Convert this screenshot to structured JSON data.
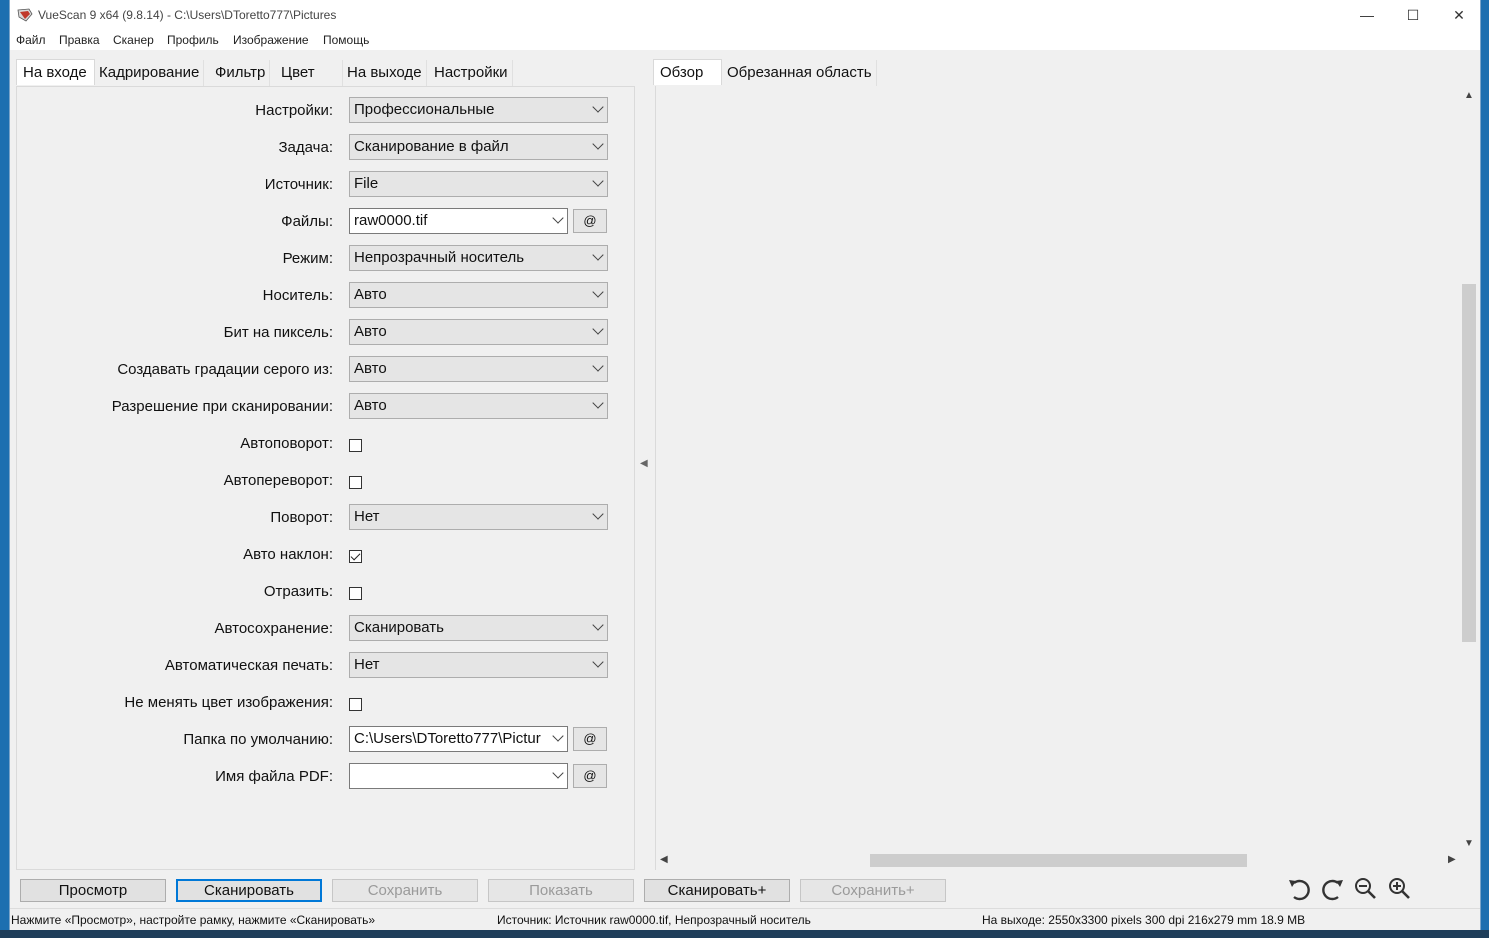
{
  "window": {
    "title": "VueScan 9 x64 (9.8.14) - C:\\Users\\DToretto777\\Pictures",
    "minimize": "—",
    "maximize": "☐",
    "close": "✕"
  },
  "menu": [
    "Файл",
    "Правка",
    "Сканер",
    "Профиль",
    "Изображение",
    "Помощь"
  ],
  "left_tabs": [
    "На входе",
    "Кадрирование",
    "Фильтр",
    "Цвет",
    "На выходе",
    "Настройки"
  ],
  "right_tabs": [
    "Обзор",
    "Обрезанная область"
  ],
  "form": {
    "settings": {
      "label": "Настройки:",
      "value": "Профессиональные"
    },
    "task": {
      "label": "Задача:",
      "value": "Сканирование в файл"
    },
    "source": {
      "label": "Источник:",
      "value": "File"
    },
    "files": {
      "label": "Файлы:",
      "value": "raw0000.tif",
      "button": "@"
    },
    "mode": {
      "label": "Режим:",
      "value": "Непрозрачный носитель"
    },
    "media": {
      "label": "Носитель:",
      "value": "Авто"
    },
    "bits": {
      "label": "Бит на пиксель:",
      "value": "Авто"
    },
    "gray_from": {
      "label": "Создавать градации серого из:",
      "value": "Авто"
    },
    "scan_res": {
      "label": "Разрешение при сканировании:",
      "value": "Авто"
    },
    "auto_rotate": {
      "label": "Автоповорот:",
      "checked": false
    },
    "auto_flip": {
      "label": "Автопереворот:",
      "checked": false
    },
    "rotation": {
      "label": "Поворот:",
      "value": "Нет"
    },
    "auto_skew": {
      "label": "Авто наклон:",
      "checked": true
    },
    "mirror": {
      "label": "Отразить:",
      "checked": false
    },
    "autosave": {
      "label": "Автосохранение:",
      "value": "Сканировать"
    },
    "autoprint": {
      "label": "Автоматическая печать:",
      "value": "Нет"
    },
    "keep_color": {
      "label": "Не менять цвет изображения:",
      "checked": false
    },
    "default_folder": {
      "label": "Папка по умолчанию:",
      "value": "C:\\Users\\DToretto777\\Pictur",
      "button": "@"
    },
    "pdf_name": {
      "label": "Имя файла PDF:",
      "value": "",
      "button": "@"
    }
  },
  "buttons": {
    "preview": "Просмотр",
    "scan": "Сканировать",
    "save": "Сохранить",
    "show": "Показать",
    "scan_plus": "Сканировать+",
    "save_plus": "Сохранить+"
  },
  "status": {
    "hint": "Нажмите «Просмотр», настройте рамку, нажмите «Сканировать»",
    "source": "Источник: Источник raw0000.tif, Непрозрачный носитель",
    "output": "На выходе: 2550x3300 pixels 300 dpi 216x279 mm 18.9 MB"
  },
  "colors": {
    "accent": "#0078d7",
    "titlebar": "#ffffff",
    "panel": "#f0f0f0"
  }
}
